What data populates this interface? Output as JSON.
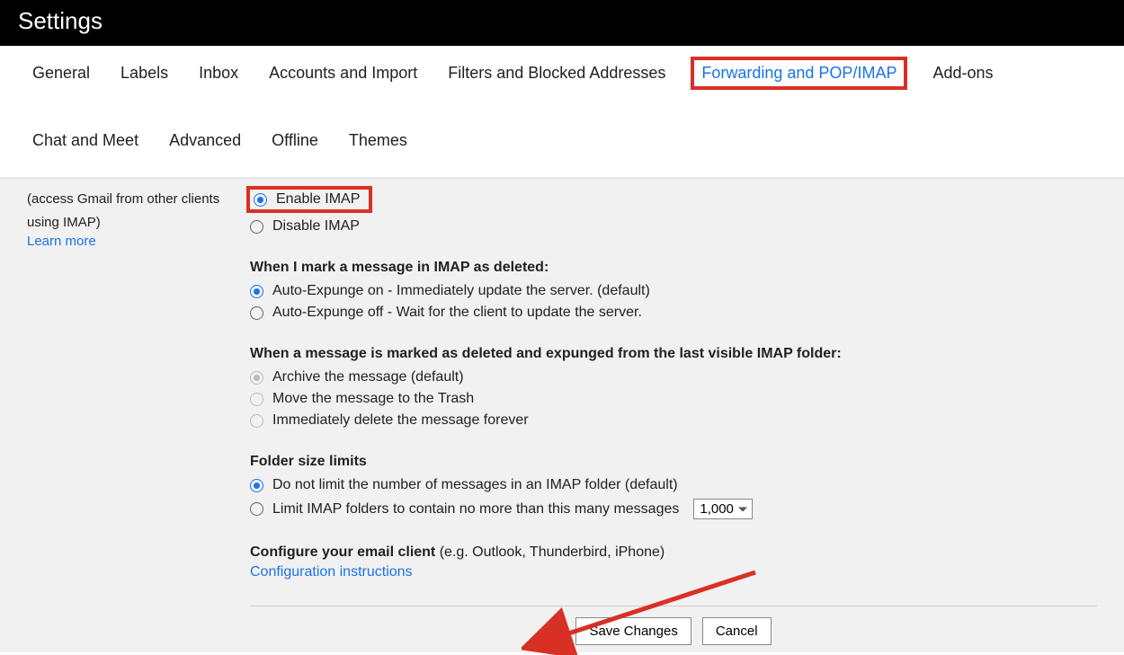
{
  "header": {
    "title": "Settings"
  },
  "tabs": [
    {
      "label": "General",
      "active": false
    },
    {
      "label": "Labels",
      "active": false
    },
    {
      "label": "Inbox",
      "active": false
    },
    {
      "label": "Accounts and Import",
      "active": false
    },
    {
      "label": "Filters and Blocked Addresses",
      "active": false
    },
    {
      "label": "Forwarding and POP/IMAP",
      "active": true,
      "highlight": true
    },
    {
      "label": "Add-ons",
      "active": false
    },
    {
      "label": "Chat and Meet",
      "active": false
    },
    {
      "label": "Advanced",
      "active": false
    },
    {
      "label": "Offline",
      "active": false
    },
    {
      "label": "Themes",
      "active": false
    }
  ],
  "sidebar": {
    "note_line1": "(access Gmail from other clients",
    "note_line2": "using IMAP)",
    "learn_more": "Learn more"
  },
  "imap_access": {
    "enable_label": "Enable IMAP",
    "disable_label": "Disable IMAP"
  },
  "expunge": {
    "heading": "When I mark a message in IMAP as deleted:",
    "on_label": "Auto-Expunge on - Immediately update the server. (default)",
    "off_label": "Auto-Expunge off - Wait for the client to update the server."
  },
  "deleted_action": {
    "heading": "When a message is marked as deleted and expunged from the last visible IMAP folder:",
    "archive_label": "Archive the message (default)",
    "trash_label": "Move the message to the Trash",
    "delete_forever_label": "Immediately delete the message forever"
  },
  "folder_limits": {
    "heading": "Folder size limits",
    "no_limit_label": "Do not limit the number of messages in an IMAP folder (default)",
    "limit_label": "Limit IMAP folders to contain no more than this many messages",
    "limit_value": "1,000"
  },
  "configure": {
    "bold": "Configure your email client",
    "rest": " (e.g. Outlook, Thunderbird, iPhone)",
    "link": "Configuration instructions"
  },
  "buttons": {
    "save": "Save Changes",
    "cancel": "Cancel"
  },
  "colors": {
    "accent": "#1a73e8",
    "highlight": "#d93025"
  }
}
